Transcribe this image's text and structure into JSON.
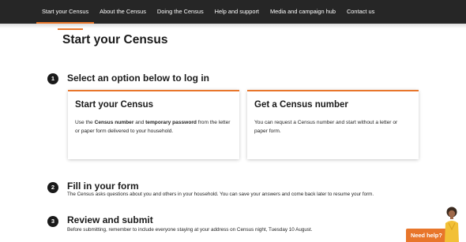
{
  "nav": {
    "items": [
      {
        "label": "Start your Census",
        "active": true
      },
      {
        "label": "About the Census"
      },
      {
        "label": "Doing the Census"
      },
      {
        "label": "Help and support"
      },
      {
        "label": "Media and campaign hub"
      },
      {
        "label": "Contact us"
      }
    ]
  },
  "page": {
    "title": "Start your Census"
  },
  "steps": [
    {
      "number": "1",
      "title": "Select an option below to log in"
    },
    {
      "number": "2",
      "title": "Fill in your form",
      "description": "The Census asks questions about you and others in your household. You can save your answers and come back later to resume your form."
    },
    {
      "number": "3",
      "title": "Review and submit",
      "description": "Before submitting, remember to include everyone staying at your address on Census night, Tuesday 10 August."
    }
  ],
  "cards": {
    "start": {
      "title": "Start your Census",
      "body_pre": "Use the ",
      "body_bold1": "Census number",
      "body_mid": " and ",
      "body_bold2": "temporary password",
      "body_post": " from the letter or paper form delivered to your household."
    },
    "get_number": {
      "title": "Get a Census number",
      "body": "You can request a Census number and start without a letter or paper form."
    }
  },
  "help": {
    "label": "Need help?"
  },
  "colors": {
    "accent": "#e8762b",
    "nav_bg": "#262626",
    "text": "#1a1a1a"
  }
}
